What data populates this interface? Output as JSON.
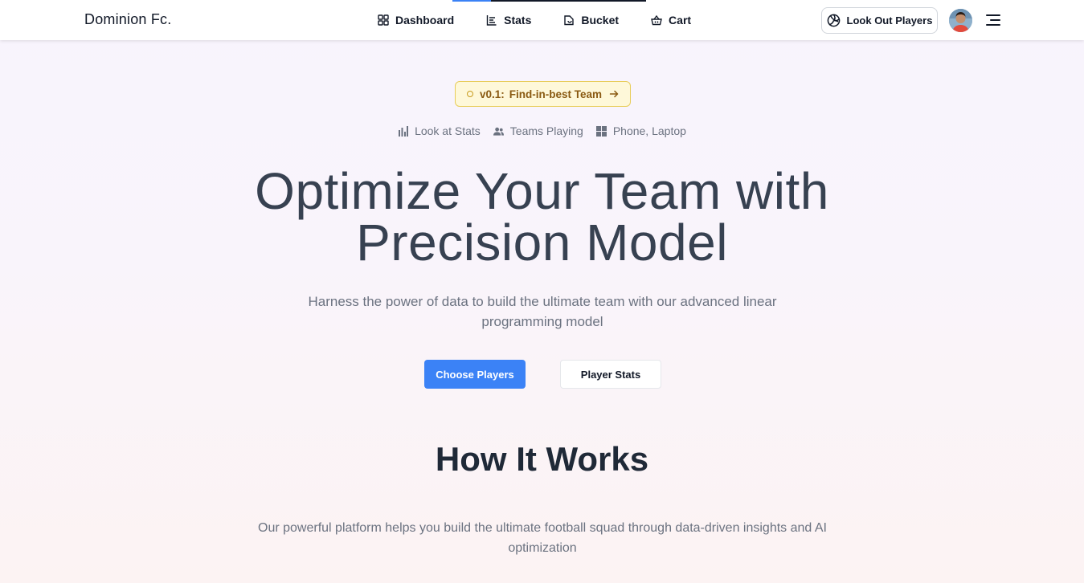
{
  "brand": "Dominion Fc.",
  "nav": [
    {
      "label": "Dashboard",
      "icon": "grid-icon"
    },
    {
      "label": "Stats",
      "icon": "list-icon"
    },
    {
      "label": "Bucket",
      "icon": "bucket-icon"
    },
    {
      "label": "Cart",
      "icon": "basket-icon"
    }
  ],
  "header": {
    "cta_label": "Look Out Players",
    "cta_icon": "volleyball-icon"
  },
  "badge": {
    "version": "v0.1:",
    "text": "Find-in-best Team"
  },
  "features": [
    {
      "label": "Look at Stats",
      "icon": "bar-chart-icon"
    },
    {
      "label": "Teams Playing",
      "icon": "users-icon"
    },
    {
      "label": "Phone, Laptop",
      "icon": "windows-icon"
    }
  ],
  "hero": {
    "title_line1": "Optimize Your Team with",
    "title_line2": "Precision Model",
    "subtitle": "Harness the power of data to build the ultimate team with our advanced linear programming model",
    "primary_button": "Choose Players",
    "secondary_button": "Player Stats"
  },
  "how_it_works": {
    "title": "How It Works",
    "subtitle": "Our powerful platform helps you build the ultimate football squad through data-driven insights and AI optimization"
  },
  "colors": {
    "accent": "#3b82f6",
    "badge_bg": "#fef8d9",
    "badge_border": "#e8cd5a",
    "badge_text": "#8a5a12",
    "heading": "#374151"
  }
}
